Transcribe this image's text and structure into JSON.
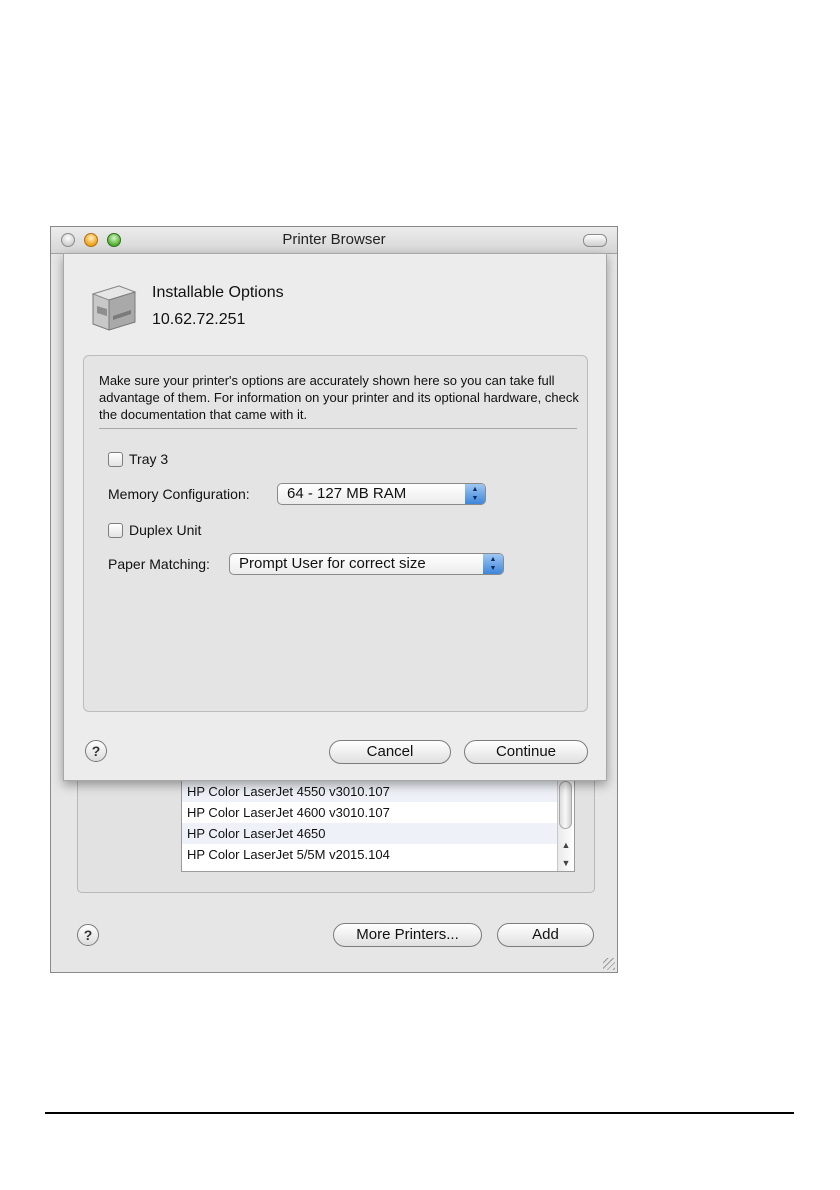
{
  "window": {
    "title": "Printer Browser",
    "help_label": "?",
    "more_printers_label": "More Printers...",
    "add_label": "Add"
  },
  "printer_list": {
    "items": [
      "HP Color LaserJet 4550 v3010.107",
      "HP Color LaserJet 4600 v3010.107",
      "HP Color LaserJet 4650",
      "HP Color LaserJet 5/5M v2015.104"
    ],
    "scroll_up": "▲",
    "scroll_down": "▼"
  },
  "sheet": {
    "title": "Installable Options",
    "ip": "10.62.72.251",
    "description": "Make sure your printer's options are accurately shown here so you can take full advantage of them.  For information on your printer and its optional hardware, check the documentation that came with it.",
    "tray_label": "Tray 3",
    "tray_checked": false,
    "memory_label": "Memory Configuration:",
    "memory_value": "64 - 127 MB RAM",
    "duplex_label": "Duplex Unit",
    "duplex_checked": false,
    "paper_label": "Paper Matching:",
    "paper_value": "Prompt User for correct size",
    "help_label": "?",
    "cancel_label": "Cancel",
    "continue_label": "Continue"
  },
  "icons": [
    "printer-icon",
    "help-icon",
    "popup-arrows-icon",
    "resize-grip-icon"
  ],
  "colors": {
    "popup_accent": "#3e86db",
    "window_bg": "#e6e6e6"
  }
}
